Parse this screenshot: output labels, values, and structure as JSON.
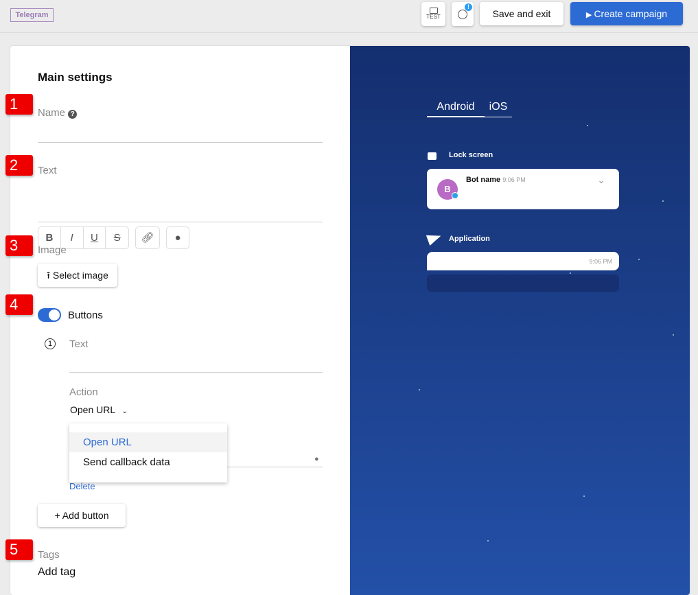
{
  "header": {
    "logo": "Telegram",
    "test_label": "TEST",
    "save_label": "Save and exit",
    "create_label": "Create campaign"
  },
  "badges": [
    "1",
    "2",
    "3",
    "4",
    "5"
  ],
  "form": {
    "title": "Main settings",
    "name_label": "Name",
    "text_label": "Text",
    "format": {
      "bold": "B",
      "italic": "I",
      "underline": "U",
      "strike": "S"
    },
    "image_label": "Image",
    "select_image": "Select image",
    "buttons_label": "Buttons",
    "buttons_enabled": true,
    "button_index": "1",
    "button_text_label": "Text",
    "action_label": "Action",
    "action_value": "Open URL",
    "action_options": [
      "Open URL",
      "Send callback data"
    ],
    "delete_label": "Delete",
    "add_button": "Add button",
    "tags_label": "Tags",
    "add_tag": "Add tag"
  },
  "preview": {
    "tabs": [
      "Android",
      "iOS"
    ],
    "active_tab": "Android",
    "lock_screen": "Lock screen",
    "bot_initial": "B",
    "bot_name": "Bot name",
    "time": "9:06 PM",
    "application": "Application",
    "app_time": "9:06 PM"
  },
  "colors": {
    "accent": "#2d6bd4",
    "badge": "#e00000"
  }
}
